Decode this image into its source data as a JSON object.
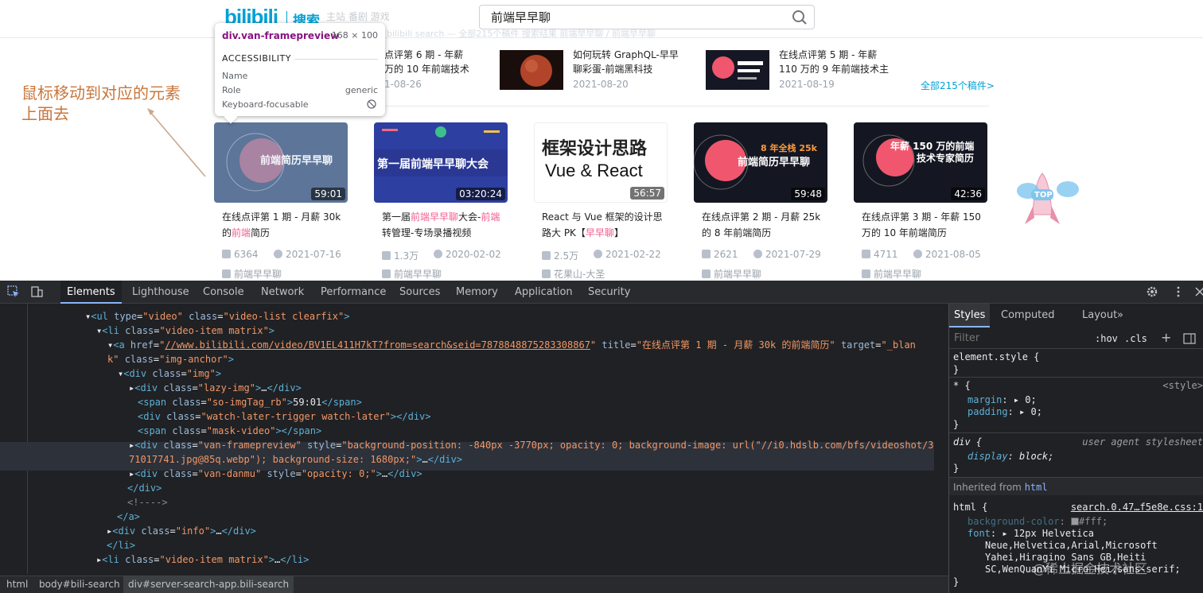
{
  "site": {
    "logo": "bilibili",
    "logo_sub": "搜索",
    "faded_nav": "主站   番剧   游戏",
    "search_value": "前端早早聊",
    "faded_line": "bilibili search — 全部215个稿件 搜索结果 前端早早聊 / 前端早早聊",
    "row1": [
      {
        "title": "点评第 6 期 - 年薪\n万的 10 年前端技术",
        "date": "1-08-26"
      },
      {
        "title": "如何玩转 GraphQL-早早\n聊彩蛋-前端黑科技",
        "date": "2021-08-20"
      },
      {
        "title": "在线点评第 5 期 - 年薪\n110 万的 9 年前端技术主",
        "date": "2021-08-19"
      }
    ],
    "all_count": "全部215个稿件>",
    "annotation_line1": "鼠标移动到对应的元素",
    "annotation_line2": "上面去",
    "cards": [
      {
        "thumb_text": "前端简历早早聊",
        "duration": "59:01",
        "title_parts": [
          "在线点评第 1 期 - 月薪 30k 的",
          "前端",
          "简历"
        ],
        "views": "6364",
        "date": "2021-07-16",
        "uploader": "前端早早聊",
        "bg": "#1b2a44"
      },
      {
        "thumb_text": "第一届前端早早聊大会",
        "duration": "03:20:24",
        "title_parts": [
          "第一届",
          "前端早早聊",
          "大会-",
          "前端",
          "转管理-专场录播视频"
        ],
        "views": "1.3万",
        "date": "2020-02-02",
        "uploader": "前端早早聊",
        "bg": "#2f3f9c"
      },
      {
        "thumb_text_a": "框架设计思路",
        "thumb_text_b": "Vue & React",
        "duration": "56:57",
        "title_parts": [
          "React 与 Vue 框架的设计思路大 PK【",
          "早早聊",
          "】"
        ],
        "views": "2.5万",
        "date": "2021-02-22",
        "uploader": "花果山-大圣",
        "bg": "#ffffff"
      },
      {
        "thumb_text": "前端简历早早聊",
        "thumb_top": "8 年全栈 25k",
        "duration": "59:48",
        "title_parts": [
          "在线点评第 2 期 - 月薪 25k 的 8 年前端简历"
        ],
        "views": "2621",
        "date": "2021-07-29",
        "uploader": "前端早早聊",
        "bg": "#141722"
      },
      {
        "thumb_text": "技术专家简历",
        "thumb_top": "年薪 150 万的前端",
        "duration": "42:36",
        "title_parts": [
          "在线点评第 3 期 - 年薪 150 万的 10 年前端简历"
        ],
        "views": "4711",
        "date": "2021-08-05",
        "uploader": "前端早早聊",
        "bg": "#141722"
      }
    ],
    "rocket_label": "TOP"
  },
  "tooltip": {
    "selector": "div.van-framepreview",
    "size": "168 × 100",
    "section": "ACCESSIBILITY",
    "name_label": "Name",
    "role_label": "Role",
    "role_value": "generic",
    "kb_label": "Keyboard-focusable"
  },
  "devtools": {
    "tabs": [
      "Elements",
      "Lighthouse",
      "Console",
      "Network",
      "Performance",
      "Sources",
      "Memory",
      "Application",
      "Security"
    ],
    "active_tab": "Elements",
    "side_tabs": [
      "Styles",
      "Computed",
      "Layout"
    ],
    "filter_placeholder": "Filter",
    "hov": ":hov",
    "cls": ".cls",
    "breadcrumbs": [
      "html",
      "body#bili-search",
      "div#server-search-app.bili-search"
    ],
    "dom_text": {
      "ul_type": "video",
      "ul_class": "video-list clearfix",
      "li_class": "video-item matrix",
      "a_href": "//www.bilibili.com/video/BV1EL411H7kT?from=search&seid=7878848875283308867",
      "a_title": "在线点评第 1 期 - 月薪 30k 的前端简历",
      "a_target_part": "_blan",
      "a_target_rest": "k",
      "a_class": "img-anchor",
      "div_img": "img",
      "lazy_img": "lazy-img",
      "span_tag_class": "so-imgTag_rb",
      "span_tag_text": "59:01",
      "watch_later": "watch-later-trigger watch-later",
      "mask_video": "mask-video",
      "frame_class": "van-framepreview",
      "frame_style_1": "background-position: -840px -3770px; opacity: 0; background-image: url(\"//i0.hdslb.com/bfs/videoshot/3",
      "frame_style_2": "71017741.jpg@85q.webp\"); background-size: 1680px;",
      "danmu_class": "van-danmu",
      "danmu_style": "opacity: 0;",
      "info_class": "info"
    },
    "styles": {
      "element_style": "element.style {",
      "star": "* {",
      "style_src": "<style>",
      "margin": "margin",
      "margin_val": "0;",
      "padding": "padding",
      "padding_val": "0;",
      "div_sel": "div {",
      "ua": "user agent stylesheet",
      "display": "display",
      "display_val": "block;",
      "inherited": "Inherited from",
      "inherited_el": "html",
      "html_sel": "html {",
      "html_src": "search.0.47…f5e8e.css:1",
      "bg": "background-color",
      "bg_val": "#fff;",
      "font": "font",
      "font_val1": "12px Helvetica",
      "font_val2": "Neue,Helvetica,Arial,Microsoft",
      "font_val3": "Yahei,Hiragino Sans GB,Heiti",
      "font_val4": "SC,WenQuanYi Micro Hei,sans-serif;",
      "watermark": "@稀土掘金技术社区"
    }
  }
}
